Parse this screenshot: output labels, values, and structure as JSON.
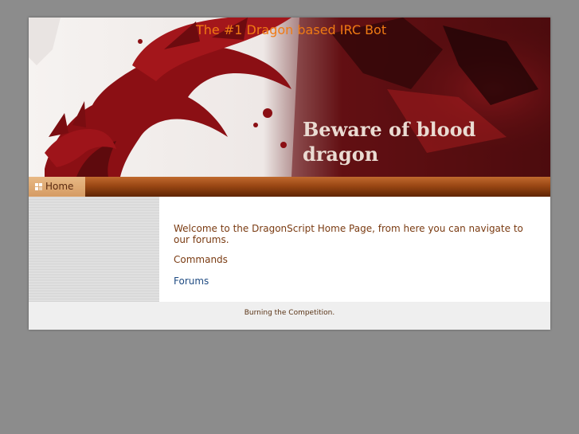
{
  "header": {
    "site_title": "The #1 Dragon based IRC Bot",
    "banner_line1": "Beware of blood",
    "banner_line2": "dragon"
  },
  "nav": {
    "items": [
      {
        "label": "Home",
        "icon": "grid-icon"
      }
    ]
  },
  "content": {
    "welcome": "Welcome to the DragonScript Home Page, from here you can navigate to our forums.",
    "commands": "Commands",
    "forums": "Forums"
  },
  "footer": {
    "text": "Burning the Competition."
  },
  "colors": {
    "background": "#8c8c8c",
    "title": "#f07a13",
    "nav_dark": "#5f2504",
    "nav_active": "#e8b985",
    "text_brown": "#7a3b12",
    "link_blue": "#1f4b82",
    "dragon_red": "#8b0f14"
  }
}
